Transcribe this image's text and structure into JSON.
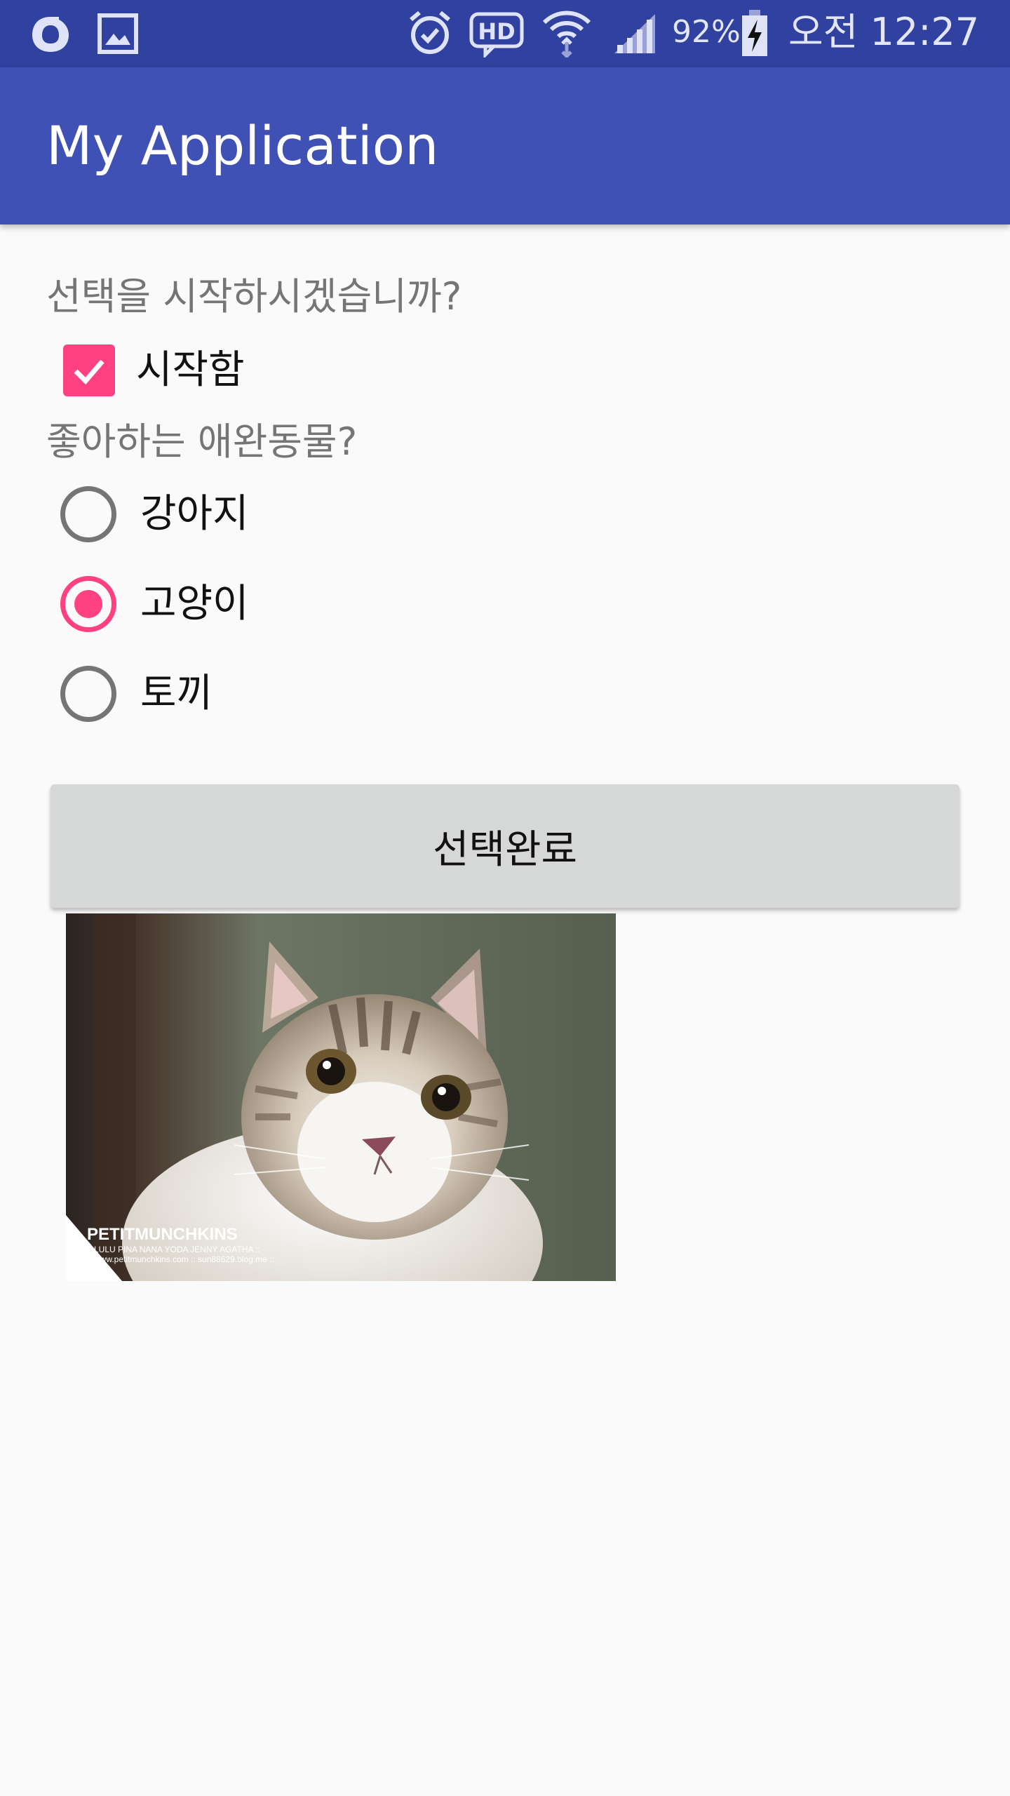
{
  "status_bar": {
    "battery": "92%",
    "time": "오전 12:27",
    "icons": [
      "carrier-o-icon",
      "gallery-icon",
      "alarm-icon",
      "hd-icon",
      "wifi-icon",
      "signal-icon",
      "battery-charging-icon"
    ],
    "background": "#3041a0"
  },
  "app_bar": {
    "title": "My Application",
    "background": "#3f51b5"
  },
  "form": {
    "question1": "선택을 시작하시겠습니까?",
    "checkbox": {
      "label": "시작함",
      "checked": true
    },
    "question2": "좋아하는 애완동물?",
    "options": [
      {
        "label": "강아지",
        "selected": false
      },
      {
        "label": "고양이",
        "selected": true
      },
      {
        "label": "토끼",
        "selected": false
      }
    ],
    "submit_label": "선택완료",
    "accent_color": "#ff4081"
  },
  "image": {
    "subject": "kitten photo",
    "watermark_title": "PETITMUNCHKINS",
    "watermark_line1": ":: LULU PINA NANA YODA JENNY AGATHA ::",
    "watermark_line2": ":: www.petitmunchkins.com :: sun88629.blog.me ::"
  }
}
